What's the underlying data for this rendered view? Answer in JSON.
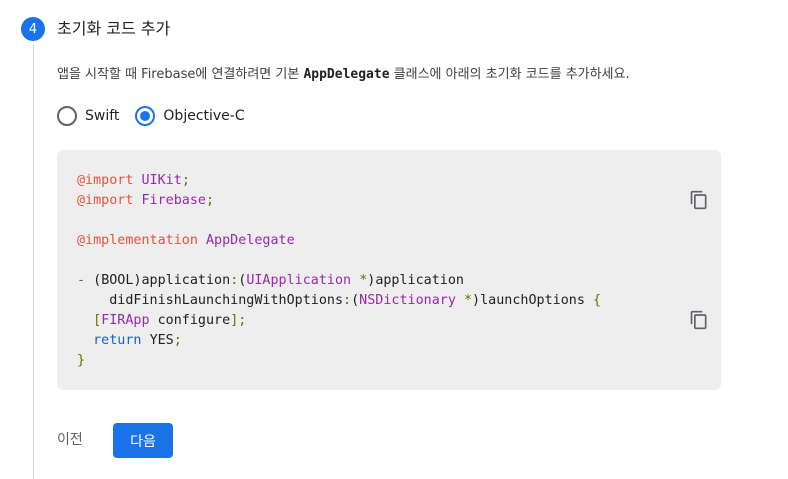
{
  "step": {
    "number": "4",
    "title": "초기화 코드 추가"
  },
  "instruction": {
    "before": "앱을 시작할 때 Firebase에 연결하려면 기본 ",
    "code": "AppDelegate",
    "after": " 클래스에 아래의 초기화 코드를 추가하세요."
  },
  "language_options": {
    "selected": "Objective-C",
    "options": [
      "Swift",
      "Objective-C"
    ]
  },
  "code_lines": {
    "l1_kw": "@import",
    "l1_mod": "UIKit",
    "l2_kw": "@import",
    "l2_mod": "Firebase",
    "l3_kw": "@implementation",
    "l3_cls": "AppDelegate",
    "l4_text": "application",
    "l4_type": "UIApplication",
    "l4_type_ret": "BOOL",
    "l4_arg": "application",
    "l5_sel": "didFinishLaunchingWithOptions",
    "l5_type": "NSDictionary",
    "l5_arg": "launchOptions",
    "l6_cls": "FIRApp",
    "l6_msg": "configure",
    "l7_kw": "return",
    "l7_val": "YES"
  },
  "icons": {
    "copy": "copy-icon"
  },
  "actions": {
    "prev_label": "이전",
    "next_label": "다음"
  },
  "colors": {
    "accent": "#1a73e8",
    "code_bg": "#eeeeee",
    "import_keyword": "#e5533d",
    "type": "#9c27b0",
    "keyword": "#1565c0"
  }
}
